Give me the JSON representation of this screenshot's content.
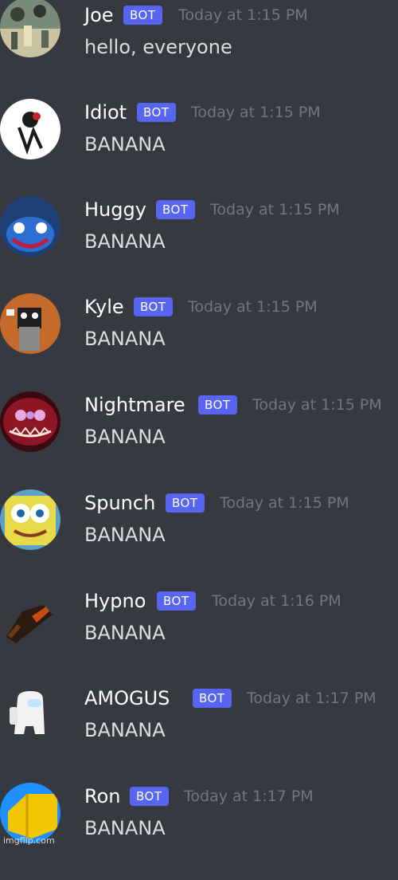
{
  "bot_tag": "BOT",
  "colors": {
    "background": "#36393f",
    "username": "#ffffff",
    "message_text": "#dcddde",
    "timestamp": "#72767d",
    "bot_tag": "#5865f2"
  },
  "messages": [
    {
      "username": "Joe",
      "timestamp": "Today at 1:15 PM",
      "content": "hello, everyone",
      "avatar": "joe-avatar"
    },
    {
      "username": "Idiot",
      "timestamp": "Today at 1:15 PM",
      "content": "BANANA",
      "avatar": "idiot-avatar"
    },
    {
      "username": "Huggy",
      "timestamp": "Today at 1:15 PM",
      "content": "BANANA",
      "avatar": "huggy-avatar"
    },
    {
      "username": "Kyle",
      "timestamp": "Today at 1:15 PM",
      "content": "BANANA",
      "avatar": "kyle-avatar"
    },
    {
      "username": "Nightmare",
      "timestamp": "Today at 1:15 PM",
      "content": "BANANA",
      "avatar": "nightmare-avatar"
    },
    {
      "username": "Spunch",
      "timestamp": "Today at 1:15 PM",
      "content": "BANANA",
      "avatar": "spunch-avatar"
    },
    {
      "username": "Hypno",
      "timestamp": "Today at 1:16 PM",
      "content": "BANANA",
      "avatar": "hypno-avatar"
    },
    {
      "username": "AMOGUS",
      "timestamp": "Today at 1:17 PM",
      "content": "BANANA",
      "avatar": "amogus-avatar"
    },
    {
      "username": "Ron",
      "timestamp": "Today at 1:17 PM",
      "content": "BANANA",
      "avatar": "ron-avatar"
    }
  ],
  "watermark": "imgflip.com"
}
